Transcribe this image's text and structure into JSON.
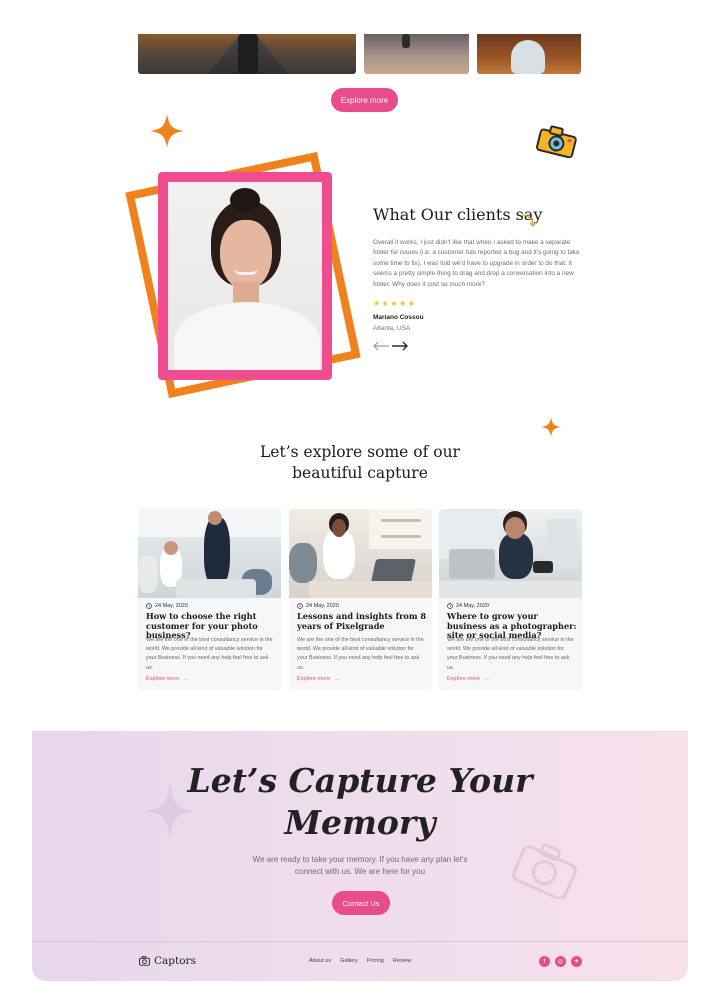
{
  "gallery": {
    "explore_label": "Explore more"
  },
  "testimonial": {
    "title": "What Our clients say",
    "quote": "Overall it works, I just didn't like that when I asked to make a separate folder for issues (i.e. a customer has reported a bug and it's going to take some time to fix), I was told we'd have to upgrade in order to do that. It seems a pretty simple thing to drag and drop a conversation into a new folder. Why does it cost so much more?",
    "rating": 5,
    "name": "Mariano Cossou",
    "location": "Atlanta, USA"
  },
  "captures": {
    "title_line1": "Let’s explore  some of our",
    "title_line2": "beautiful capture",
    "cards": [
      {
        "date": "24 May, 2020",
        "title": "How to choose the right customer for your photo business?",
        "text": "We are the one of the best consultancy service in the world. We provide all kind of valuable solution for your Business. If you need any help feel free to ask us.",
        "link": "Explore more"
      },
      {
        "date": "24 May, 2020",
        "title": "Lessons and insights from 8 years of Pixelgrade",
        "text": "We are the one of the best consultancy service in the world. We provide all kind of valuable solution for your Business. If you need any help feel free to ask us.",
        "link": "Explore more"
      },
      {
        "date": "24 May, 2020",
        "title": "Where to grow your business as a photographer: site or social media?",
        "text": "We are the one of the best consultancy service in the world. We provide all kind of valuable solution for your Business. If you need any help feel free to ask us.",
        "link": "Explore more"
      }
    ]
  },
  "cta": {
    "title_line1": "Let’s Capture Your",
    "title_line2": "Memory",
    "subtitle": "We are ready to take your memory. If you have any plan let's connect with us. We are here for you",
    "button": "Contact Us"
  },
  "footer": {
    "brand": "Captors",
    "nav": [
      "About us",
      "Gallery",
      "Pricing",
      "Review"
    ],
    "socials": [
      "facebook-icon",
      "instagram-icon",
      "twitter-icon"
    ]
  },
  "colors": {
    "accent_pink": "#e84c8b",
    "accent_orange": "#f0821e",
    "star_yellow": "#f3c21b"
  }
}
